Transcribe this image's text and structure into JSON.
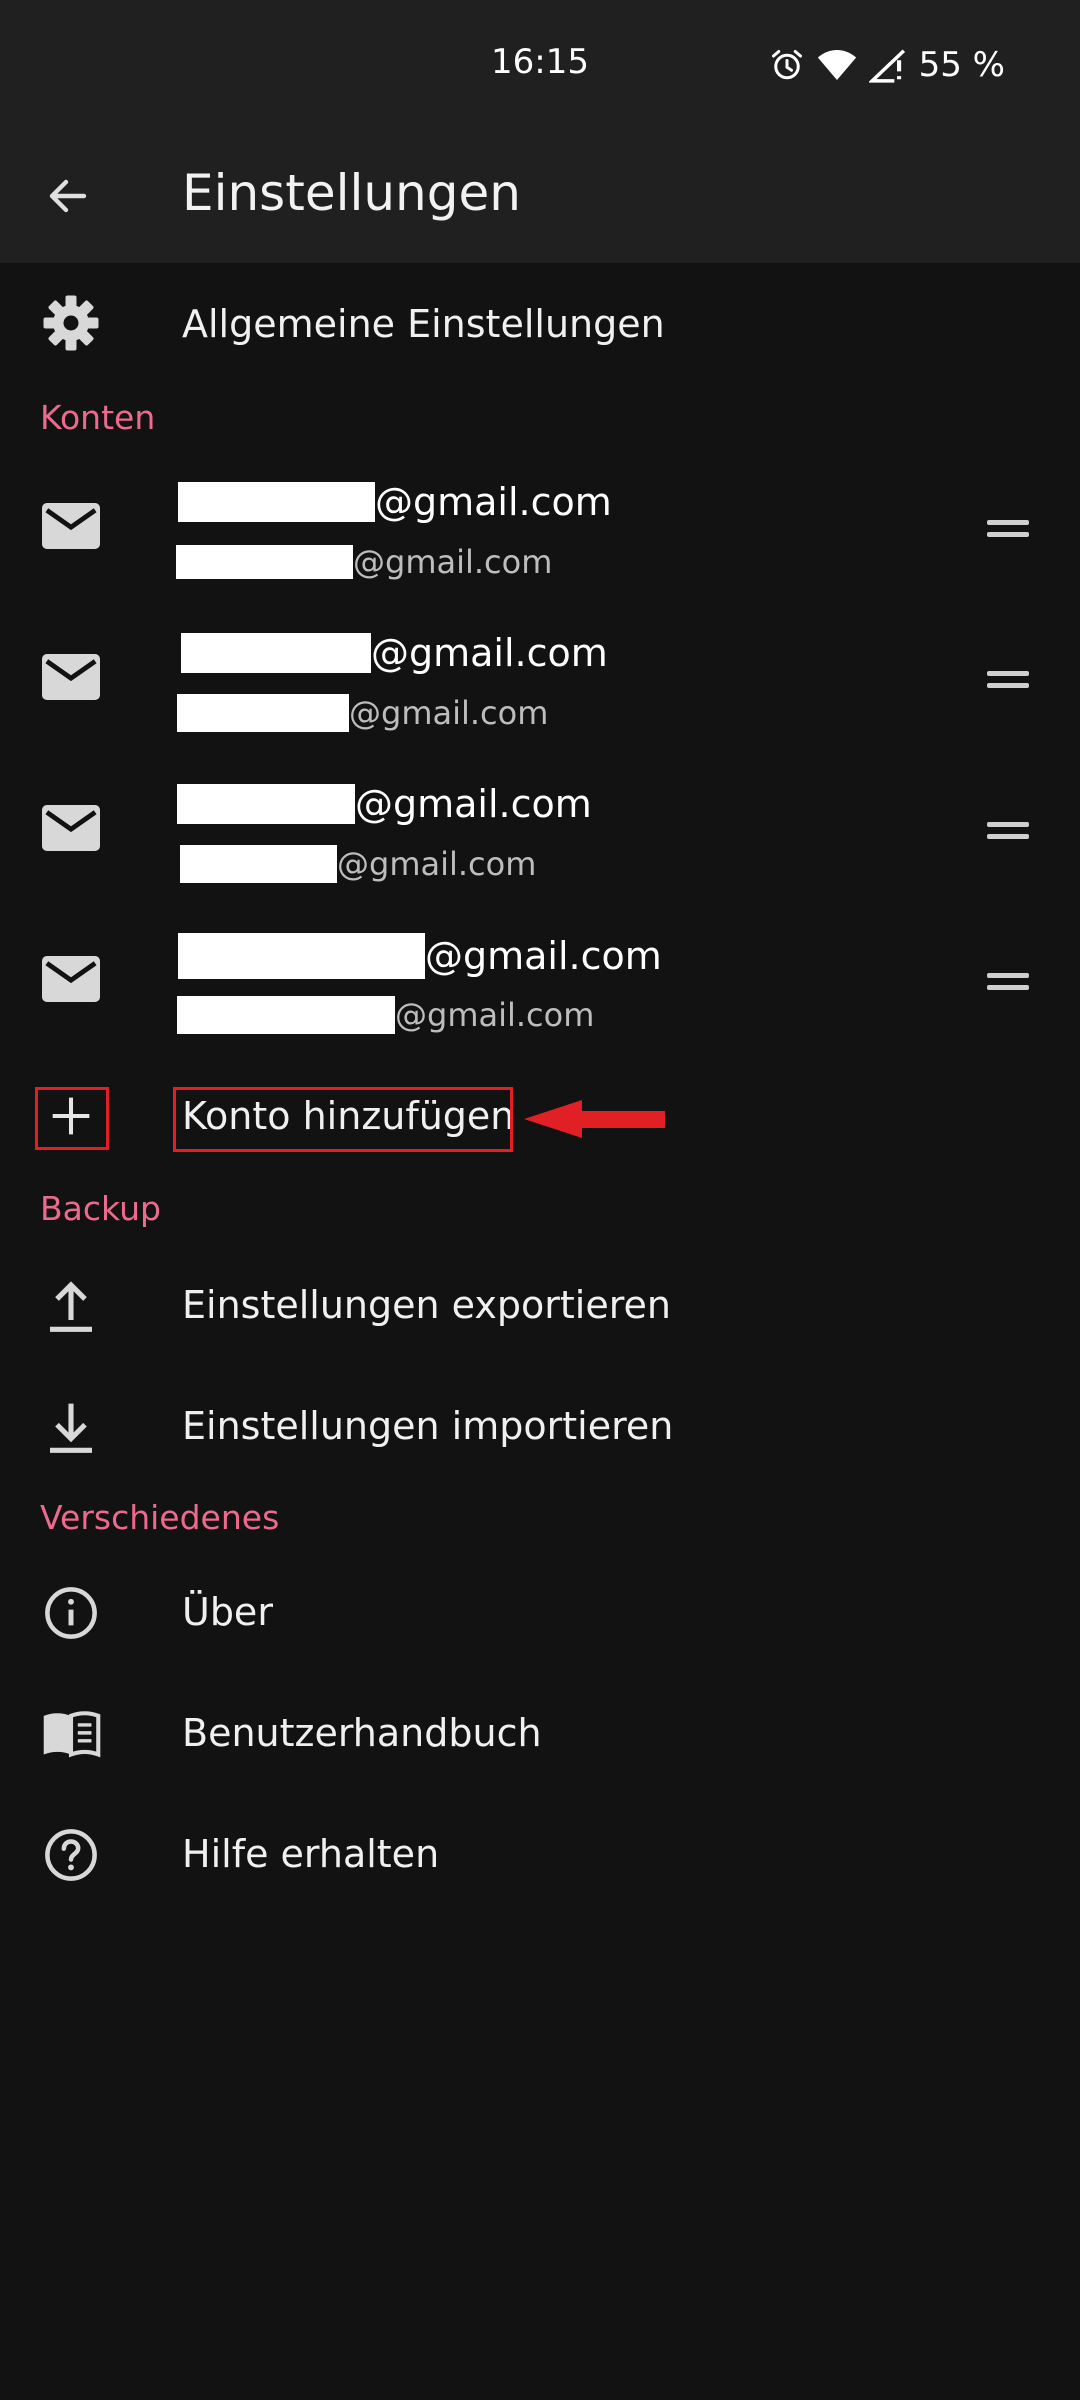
{
  "status": {
    "time": "16:15",
    "battery": "55 %"
  },
  "appbar": {
    "title": "Einstellungen"
  },
  "general": {
    "label": "Allgemeine Einstellungen"
  },
  "sections": {
    "accounts": "Konten",
    "backup": "Backup",
    "misc": "Verschiedenes"
  },
  "accounts": [
    {
      "primary_suffix": "@gmail.com",
      "secondary_suffix": "@gmail.com"
    },
    {
      "primary_suffix": "@gmail.com",
      "secondary_suffix": "@gmail.com"
    },
    {
      "primary_suffix": "@gmail.com",
      "secondary_suffix": "@gmail.com"
    },
    {
      "primary_suffix": "@gmail.com",
      "secondary_suffix": "@gmail.com"
    }
  ],
  "add_account": {
    "label": "Konto hinzufügen"
  },
  "backup": {
    "export_label": "Einstellungen exportieren",
    "import_label": "Einstellungen importieren"
  },
  "misc": {
    "about_label": "Über",
    "manual_label": "Benutzerhandbuch",
    "help_label": "Hilfe erhalten"
  },
  "colors": {
    "accent": "#ee6a8c",
    "background": "#121212",
    "bar": "#202020",
    "annotation": "#e02024"
  }
}
